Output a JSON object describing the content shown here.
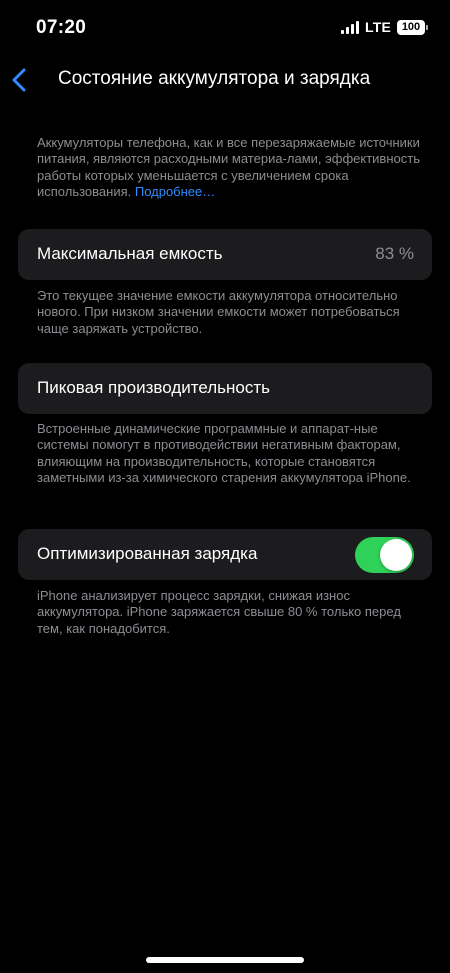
{
  "status_bar": {
    "time": "07:20",
    "network": "LTE",
    "battery_level": "100"
  },
  "nav": {
    "title": "Состояние аккумулятора и зарядка"
  },
  "intro": {
    "text": "Аккумуляторы телефона, как и все перезаряжаемые источники питания, являются расходными материа-лами, эффективность работы которых уменьшается с увеличением срока использования. ",
    "link_label": "Подробнее…"
  },
  "max_capacity": {
    "label": "Максимальная емкость",
    "value": "83 %",
    "footnote": "Это текущее значение емкости аккумулятора относительно нового. При низком значении емкости может потребоваться чаще заряжать устройство."
  },
  "peak_performance": {
    "label": "Пиковая производительность",
    "footnote": "Встроенные динамические программные и аппарат-ные системы помогут в противодействии негативным факторам, влияющим на производительность, которые становятся заметными из-за химического старения аккумулятора iPhone."
  },
  "optimized_charging": {
    "label": "Оптимизированная зарядка",
    "enabled": true,
    "footnote": "iPhone анализирует процесс зарядки, снижая износ аккумулятора. iPhone заряжается свыше 80 % только перед тем, как понадобится."
  },
  "colors": {
    "background": "#000000",
    "cell": "#1c1c1e",
    "secondary_text": "#8d8d93",
    "accent": "#2f8cff",
    "toggle_on": "#30d158"
  }
}
